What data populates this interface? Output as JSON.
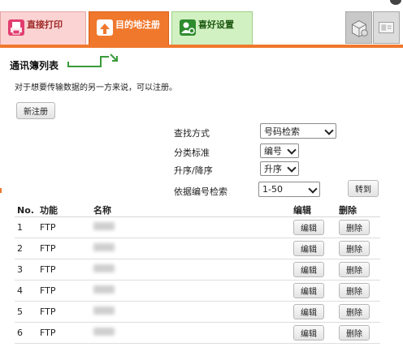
{
  "tabs": {
    "direct_print": "直接打印",
    "destination": "目的地注册",
    "preferences": "喜好设置"
  },
  "section": {
    "title": "通讯簿列表",
    "description": "对于想要传输数据的另一方来说，可以注册。",
    "new_button": "新注册"
  },
  "search": {
    "method_label": "查找方式",
    "method_value": "号码检索",
    "category_label": "分类标准",
    "category_value": "编号",
    "order_label": "升序/降序",
    "order_value": "升序",
    "range_label": "依据编号检索",
    "range_value": "1-50",
    "goto_button": "转到"
  },
  "table": {
    "headers": {
      "no": "No.",
      "function": "功能",
      "name": "名称",
      "edit": "编辑",
      "delete": "删除"
    },
    "edit_button": "编辑",
    "delete_button": "删除",
    "rows": [
      {
        "no": "1",
        "function": "FTP"
      },
      {
        "no": "2",
        "function": "FTP"
      },
      {
        "no": "3",
        "function": "FTP"
      },
      {
        "no": "4",
        "function": "FTP"
      },
      {
        "no": "5",
        "function": "FTP"
      },
      {
        "no": "6",
        "function": "FTP"
      }
    ]
  },
  "colors": {
    "accent": "#f0782d",
    "direct_tab": "#fbd3d3",
    "pref_tab": "#d2f1c2"
  }
}
